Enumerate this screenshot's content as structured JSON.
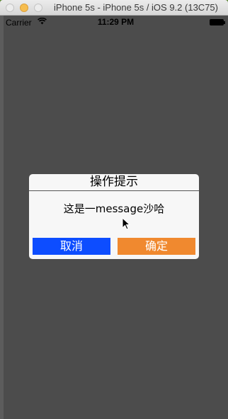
{
  "window": {
    "title": "iPhone 5s - iPhone 5s / iOS 9.2 (13C75)"
  },
  "status_bar": {
    "carrier": "Carrier",
    "wifi_icon": "wifi-icon",
    "time": "11:29 PM",
    "battery_icon": "battery-icon"
  },
  "alert": {
    "title": "操作提示",
    "message": "这是一message沙哈",
    "cancel_label": "取消",
    "confirm_label": "确定",
    "cancel_color": "#0d4dff",
    "confirm_color": "#f0892f"
  }
}
